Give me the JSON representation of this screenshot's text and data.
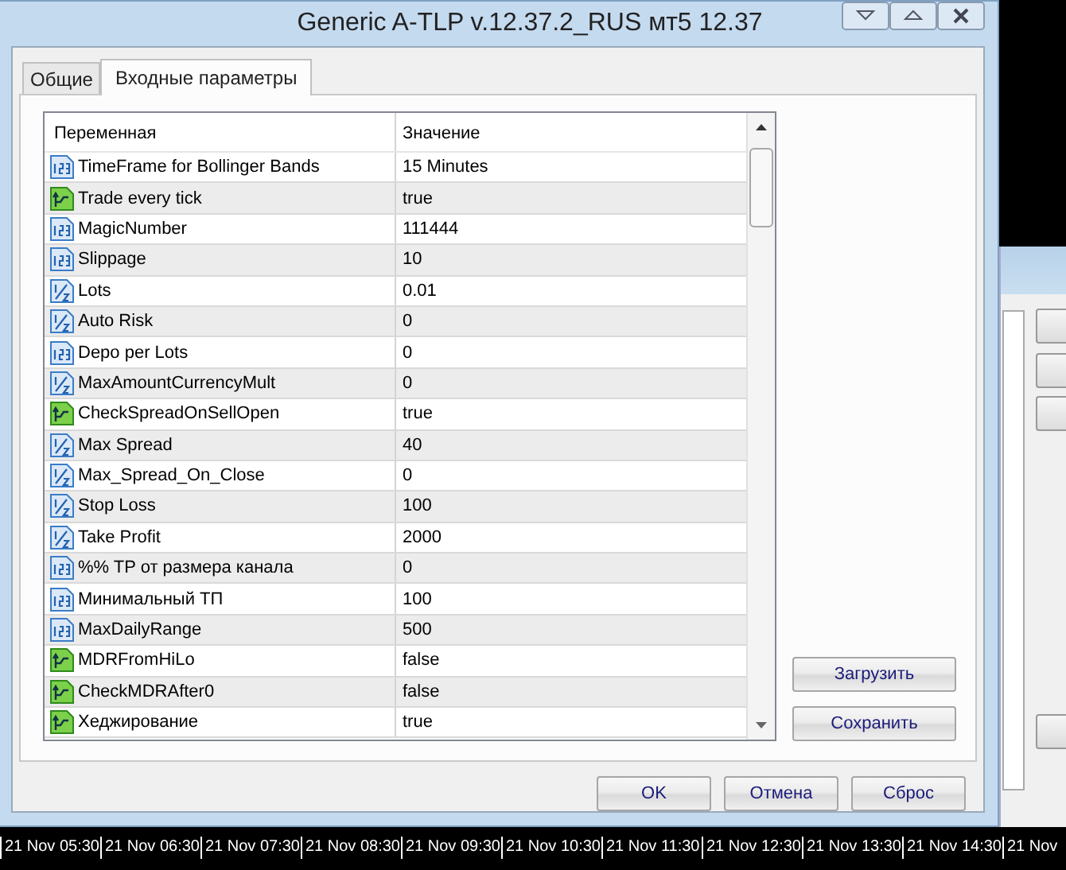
{
  "window": {
    "title": "Generic A-TLP v.12.37.2_RUS мт5 12.37"
  },
  "tabs": [
    {
      "label": "Общие",
      "selected": false
    },
    {
      "label": "Входные параметры",
      "selected": true
    }
  ],
  "table": {
    "columns": [
      "Переменная",
      "Значение"
    ],
    "rows": [
      {
        "kind": "int",
        "name": "TimeFrame for Bollinger Bands",
        "value": "15 Minutes"
      },
      {
        "kind": "bool",
        "name": "Trade every tick",
        "value": "true"
      },
      {
        "kind": "int",
        "name": "MagicNumber",
        "value": "111444"
      },
      {
        "kind": "int",
        "name": "Slippage",
        "value": "10"
      },
      {
        "kind": "double",
        "name": "Lots",
        "value": "0.01"
      },
      {
        "kind": "double",
        "name": "Auto Risk",
        "value": "0"
      },
      {
        "kind": "int",
        "name": "Depo per Lots",
        "value": "0"
      },
      {
        "kind": "double",
        "name": "MaxAmountCurrencyMult",
        "value": "0"
      },
      {
        "kind": "bool",
        "name": "CheckSpreadOnSellOpen",
        "value": "true"
      },
      {
        "kind": "double",
        "name": "Max Spread",
        "value": "40"
      },
      {
        "kind": "double",
        "name": "Max_Spread_On_Close",
        "value": "0"
      },
      {
        "kind": "double",
        "name": "Stop Loss",
        "value": "100"
      },
      {
        "kind": "double",
        "name": "Take Profit",
        "value": "2000"
      },
      {
        "kind": "int",
        "name": "%% TP от размера канала",
        "value": "0"
      },
      {
        "kind": "int",
        "name": "Минимальный ТП",
        "value": "100"
      },
      {
        "kind": "int",
        "name": "MaxDailyRange",
        "value": "500"
      },
      {
        "kind": "bool",
        "name": "MDRFromHiLo",
        "value": "false"
      },
      {
        "kind": "bool",
        "name": "CheckMDRAfter0",
        "value": "false"
      },
      {
        "kind": "bool",
        "name": "Хеджирование",
        "value": "true"
      }
    ]
  },
  "side_buttons": [
    "Загрузить",
    "Сохранить"
  ],
  "buttons": [
    "OK",
    "Отмена",
    "Сброс"
  ],
  "timeline": [
    "21 Nov 05:30",
    "21 Nov 06:30",
    "21 Nov 07:30",
    "21 Nov 08:30",
    "21 Nov 09:30",
    "21 Nov 10:30",
    "21 Nov 11:30",
    "21 Nov 12:30",
    "21 Nov 13:30",
    "21 Nov 14:30",
    "21 Nov"
  ]
}
